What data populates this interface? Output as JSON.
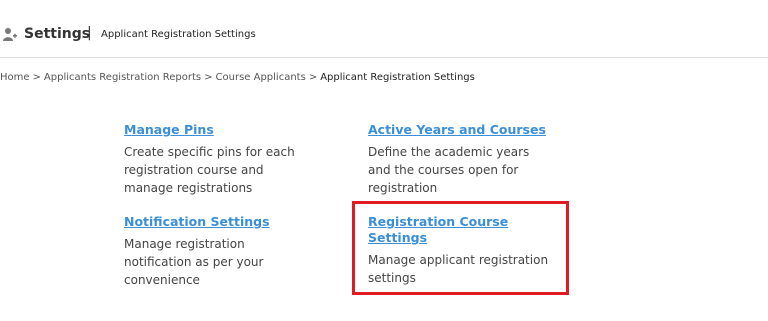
{
  "header": {
    "icon": "user-settings-icon",
    "title": "Settings",
    "separator": "|",
    "subtitle": "Applicant Registration Settings"
  },
  "breadcrumb": {
    "items": [
      "Home",
      "Applicants Registration Reports",
      "Course Applicants",
      "Applicant Registration Settings"
    ],
    "separator": ">"
  },
  "cards": {
    "pins": {
      "title": "Manage Pins",
      "description": "Create specific pins for each registration course and manage registrations"
    },
    "years": {
      "title": "Active Years and Courses",
      "description": "Define the academic years and the courses open for registration"
    },
    "notifications": {
      "title": "Notification Settings",
      "description": "Manage registration notification as per your convenience"
    },
    "course": {
      "title": "Registration Course Settings",
      "description": "Manage applicant registration settings"
    }
  },
  "colors": {
    "link": "#3a8fd6",
    "highlight": "#e01b24"
  }
}
